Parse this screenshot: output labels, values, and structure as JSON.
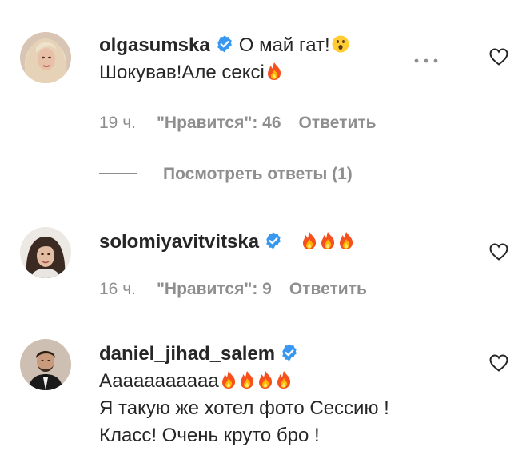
{
  "comments": [
    {
      "username": "olgasumska",
      "text_line1": "О май гат!",
      "text_line2": "Шокував!Але сексі",
      "time": "19 ч.",
      "likes": "\"Нравится\": 46",
      "reply": "Ответить",
      "view_replies": "Посмотреть ответы (1)"
    },
    {
      "username": "solomiyavitvitska",
      "time": "16 ч.",
      "likes": "\"Нравится\": 9",
      "reply": "Ответить"
    },
    {
      "username": "daniel_jihad_salem",
      "text_line1": "Ааааааааааа",
      "text_line2": "Я такую же хотел фото Сессию !",
      "text_line3": "Класс! Очень круто бро !"
    }
  ],
  "colors": {
    "text": "#262626",
    "secondary": "#8e8e8e",
    "verified": "#3897f0"
  },
  "icons": [
    "verified-badge-icon",
    "fire-emoji",
    "astonished-emoji",
    "heart-icon",
    "more-options-icon"
  ]
}
